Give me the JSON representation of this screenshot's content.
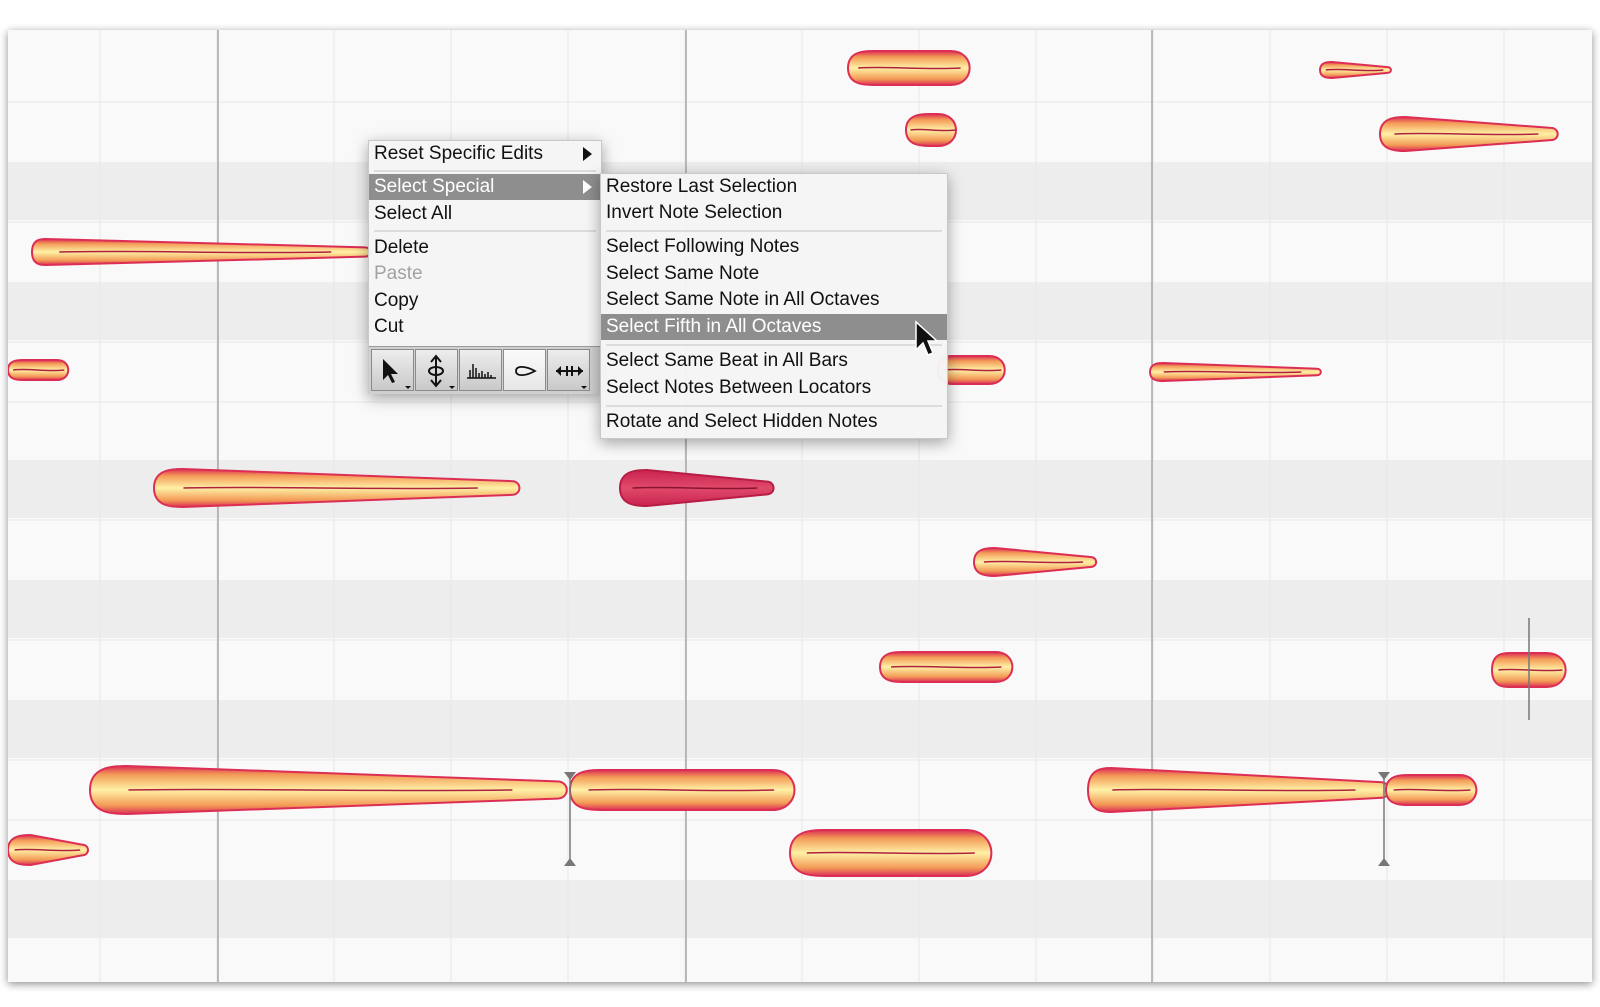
{
  "context_menu": {
    "items": [
      {
        "label": "Reset Specific Edits",
        "has_submenu": true
      },
      {
        "label": "Select Special",
        "has_submenu": true,
        "highlighted": true
      },
      {
        "label": "Select All"
      },
      {
        "label": "Delete"
      },
      {
        "label": "Paste",
        "disabled": true
      },
      {
        "label": "Copy"
      },
      {
        "label": "Cut"
      }
    ]
  },
  "submenu": {
    "items": [
      {
        "label": "Restore Last Selection"
      },
      {
        "label": "Invert Note Selection"
      },
      {
        "label": "Select Following Notes"
      },
      {
        "label": "Select Same Note"
      },
      {
        "label": "Select Same Note in All Octaves"
      },
      {
        "label": "Select Fifth in All Octaves",
        "highlighted": true
      },
      {
        "label": "Select Same Beat in All Bars"
      },
      {
        "label": "Select Notes Between Locators"
      },
      {
        "label": "Rotate and Select Hidden Notes"
      }
    ]
  },
  "toolbar": {
    "tools": [
      "main-tool",
      "pitch-tool",
      "formant-tool",
      "amplitude-tool",
      "time-tool"
    ],
    "active_tool": "amplitude-tool"
  },
  "colors": {
    "note_core": "#fff1a6",
    "note_mid": "#f7b45c",
    "note_edge": "#dc2e55",
    "selected_note": "#d6305a",
    "menu_highlight": "#8e8e8e",
    "lane_shaded": "#ededed"
  }
}
